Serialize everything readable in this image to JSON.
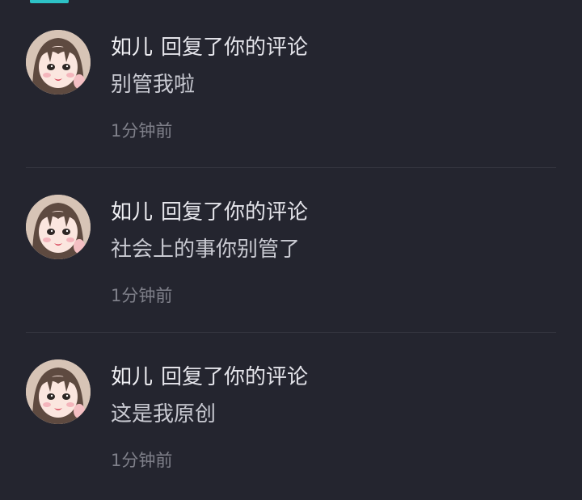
{
  "theme": {
    "background": "#24252f",
    "accent": "#2dc2c6",
    "text_primary": "#e8e8ee",
    "text_secondary": "#c9cad2",
    "text_muted": "#7f808a"
  },
  "notifications": [
    {
      "avatar_icon": "anime-girl-avatar-icon",
      "user": "如儿",
      "action": "回复了你的评论",
      "message": "别管我啦",
      "time": "1分钟前"
    },
    {
      "avatar_icon": "anime-girl-avatar-icon",
      "user": "如儿",
      "action": "回复了你的评论",
      "message": "社会上的事你别管了",
      "time": "1分钟前"
    },
    {
      "avatar_icon": "anime-girl-avatar-icon",
      "user": "如儿",
      "action": "回复了你的评论",
      "message": "这是我原创",
      "time": "1分钟前"
    }
  ]
}
